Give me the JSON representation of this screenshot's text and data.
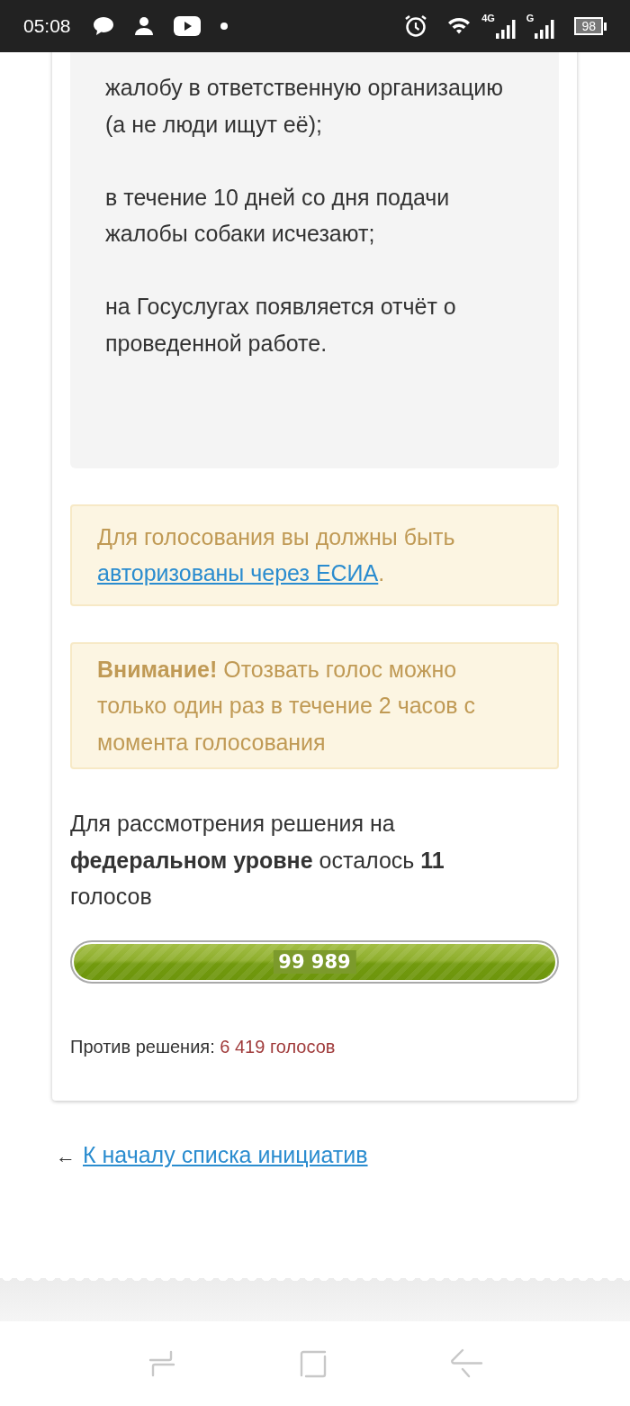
{
  "status_bar": {
    "time": "05:08",
    "networks": [
      {
        "label": "4G"
      },
      {
        "label": "G"
      }
    ],
    "battery": "98"
  },
  "initiative": {
    "paragraphs": [
      "жалобу в ответственную организацию (а не люди ищут её);",
      "в течение 10 дней со дня подачи жалобы собаки исчезают;",
      "на Госуслугах появляется отчёт о проведенной работе."
    ]
  },
  "notices": [
    {
      "kind": "auth",
      "text": "Для голосования вы должны быть",
      "link": "авторизованы через ЕСИА",
      "suffix": "."
    },
    {
      "kind": "warning",
      "text": "**Внимание!** Отозвать голос можно только один раз в течение 2 часов с момента голосования"
    }
  ],
  "remaining": "Для рассмотрения решения на **федеральном уровне** осталось **11** голосов",
  "progress": {
    "level": 0.9999,
    "label": "99 989"
  },
  "against": {
    "label": "Против решения:",
    "value": "6 419 голосов"
  },
  "back_link": {
    "arrow": "←",
    "label": "К началу списка инициатив"
  }
}
